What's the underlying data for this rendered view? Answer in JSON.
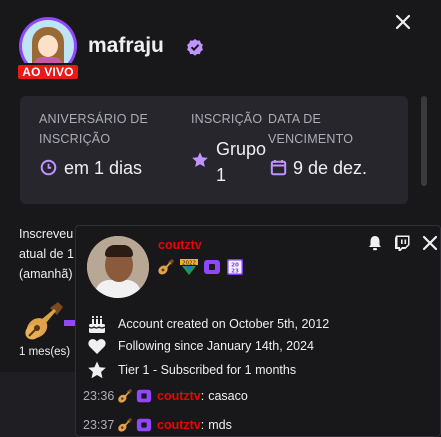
{
  "profile": {
    "username": "mafraju",
    "live_label": "AO VIVO",
    "icons": {
      "verified": "verified-badge-icon",
      "close": "close-icon"
    }
  },
  "subscription": {
    "anniversary_label_line1": "ANIVERSÁRIO DE",
    "anniversary_label_line2": "INSCRIÇÃO",
    "anniversary_value": "em 1 dias",
    "tier_label": "INSCRIÇÃO",
    "tier_value_line1": "Grupo",
    "tier_value_line2": "1",
    "expiry_label_line1": "DATA DE",
    "expiry_label_line2": "VENCIMENTO",
    "expiry_value": "9 de dez."
  },
  "info": {
    "line1": "Inscreveu",
    "line2": "atual de 1",
    "line3": "(amanhã)",
    "month_label": "1 mes(es)"
  },
  "popup": {
    "username": "coutztv",
    "account_created": "Account created on October 5th, 2012",
    "following_since": "Following since January 14th, 2024",
    "tier": "Tier 1 - Subscribed for 1 months",
    "chat": [
      {
        "time": "23:36",
        "user": "coutztv",
        "separator": ":",
        "message": "casaco"
      },
      {
        "time": "23:37",
        "user": "coutztv",
        "separator": ":",
        "message": "mds"
      }
    ]
  },
  "colors": {
    "background": "#18181b",
    "panel": "#26262c",
    "accent": "#9147ff",
    "live": "#e91916",
    "chat_username": "#eb0400",
    "muted_text": "#adadb8"
  }
}
